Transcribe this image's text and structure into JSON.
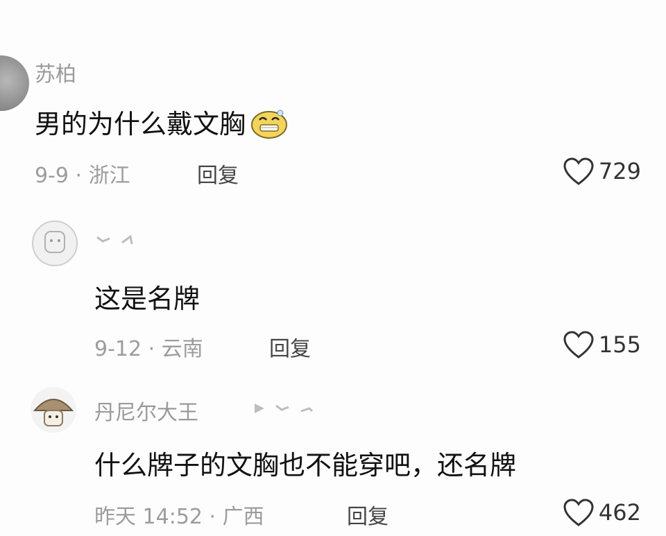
{
  "comments": [
    {
      "username": "苏柏",
      "text": "男的为什么戴文胸",
      "date_location": "9-9 · 浙江",
      "reply_label": "回复",
      "likes": "729"
    },
    {
      "username": "",
      "text": "这是名牌",
      "date_location": "9-12 · 云南",
      "reply_label": "回复",
      "likes": "155"
    },
    {
      "username": "丹尼尔大王",
      "text": "什么牌子的文胸也不能穿吧，还名牌",
      "date_location": "昨天 14:52 · 广西",
      "reply_label": "回复",
      "likes": "462"
    }
  ],
  "icons": {
    "like": "heart-outline-icon",
    "emoji": "smiling-face-emoji",
    "reply_arrow": "reply-arrow-icon"
  }
}
